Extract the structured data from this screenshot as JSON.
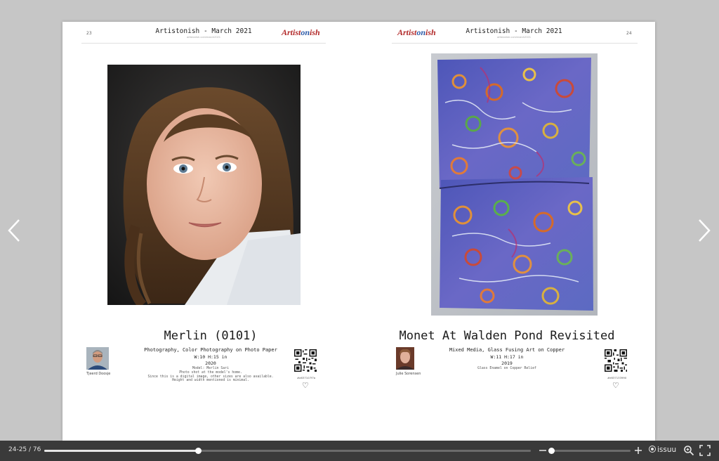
{
  "viewer": {
    "page_counter": "24-25 / 76",
    "progress_fraction": 0.316,
    "zoom_fraction": 0.02,
    "brand": "issuu"
  },
  "pages": {
    "left": {
      "page_number": "23",
      "header_title": "Artistonish - March 2021",
      "header_sub": "artistonish.com/march2021",
      "logo_part1": "Artist",
      "logo_part2": "on",
      "logo_part3": "ish",
      "art_title": "Merlin (0101)",
      "medium": "Photography, Color Photography on Photo Paper",
      "dimensions": "W:10 H:15 in",
      "year": "2020",
      "description": [
        "Model: Merlin Sari",
        "Photo shot at the model's home.",
        "Since this is a digital image, other sizes are also available.",
        "Height and width mentioned is minimal."
      ],
      "artist_name": "Tjeerd Doosje",
      "qr_code_id": "#a637107f7a",
      "heart": "♡"
    },
    "right": {
      "page_number": "24",
      "header_title": "Artistonish - March 2021",
      "header_sub": "artistonish.com/march2021",
      "logo_part1": "Artist",
      "logo_part2": "on",
      "logo_part3": "ish",
      "art_title": "Monet At Walden Pond Revisited",
      "medium": "Mixed Media, Glass Fusing Art on Copper",
      "dimensions": "W:11 H:17 in",
      "year": "2019",
      "description": [
        "Glass Enamel on Copper Relief"
      ],
      "artist_name": "Julie Sorensen",
      "qr_code_id": "#e637133990",
      "heart": "♡"
    }
  },
  "colors": {
    "logo_red": "#b22a2a",
    "logo_blue": "#2b5aa8",
    "toolbar": "#3a3a3a",
    "background": "#c6c6c6"
  }
}
